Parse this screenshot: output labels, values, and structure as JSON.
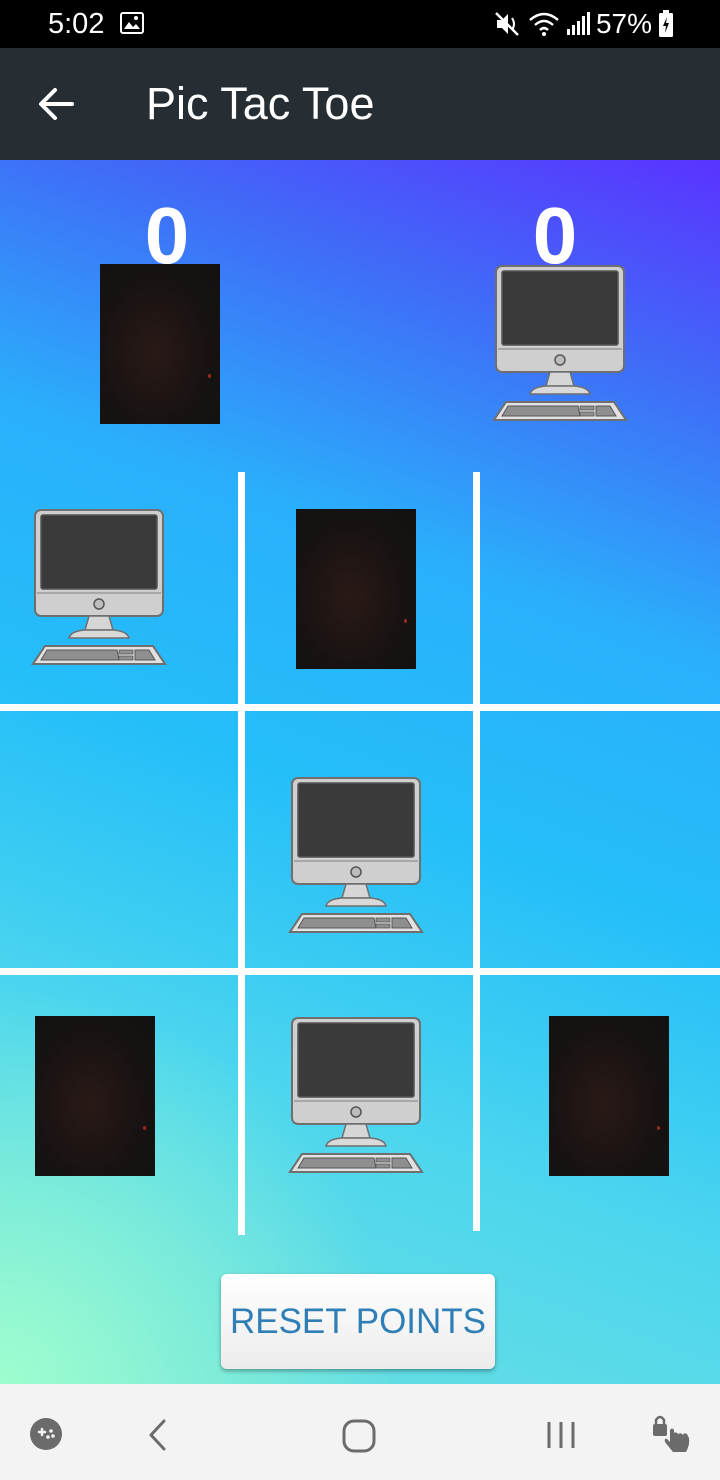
{
  "status_bar": {
    "time": "5:02",
    "battery": "57%",
    "icons": [
      "gallery-icon",
      "mute-icon",
      "wifi-icon",
      "signal-icon",
      "battery-icon"
    ]
  },
  "app_bar": {
    "title": "Pic Tac Toe",
    "back_icon": "arrow-left-icon"
  },
  "scoreboard": {
    "player_score": "0",
    "computer_score": "0"
  },
  "board": {
    "cells": [
      "computer",
      "photo",
      "",
      "",
      "computer",
      "",
      "photo",
      "computer",
      "photo"
    ]
  },
  "reset_button": {
    "label": "RESET POINTS"
  },
  "colors": {
    "app_bar": "#262e33",
    "reset_label": "#2f7fb6",
    "gradient_top": "#5a33ff",
    "gradient_mid": "#24bef9",
    "gradient_bottom": "#a0ffcd"
  },
  "nav_bar": {
    "icons": [
      "game-launcher-icon",
      "back-chevron-icon",
      "home-icon",
      "recents-icon",
      "touch-lock-icon"
    ]
  }
}
